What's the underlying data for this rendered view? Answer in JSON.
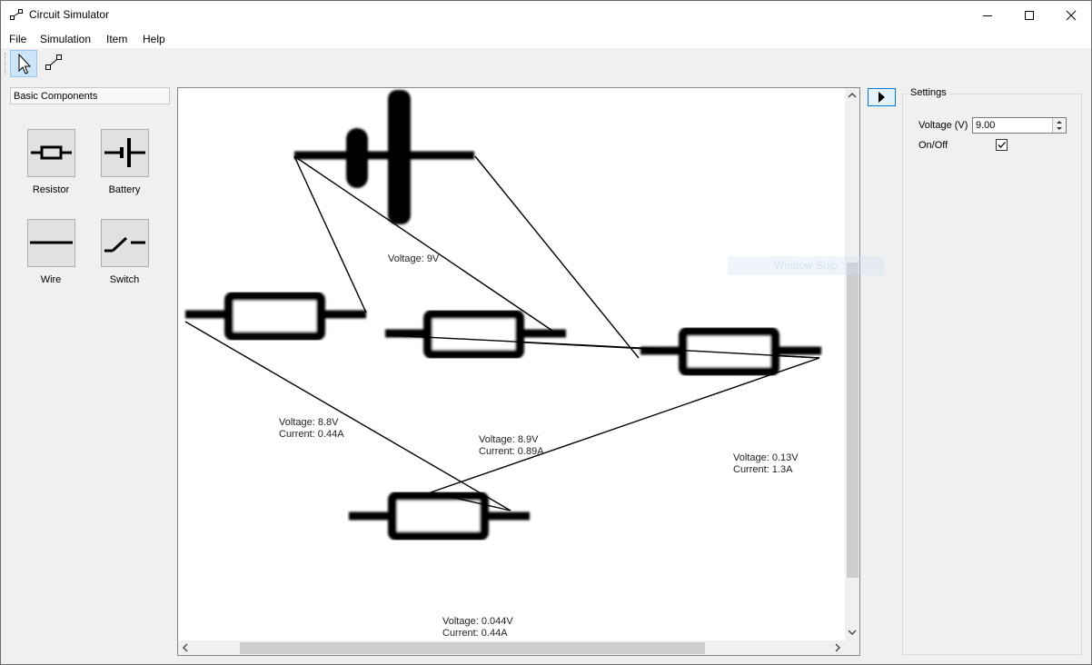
{
  "window": {
    "title": "Circuit Simulator"
  },
  "menu": [
    "File",
    "Simulation",
    "Item",
    "Help"
  ],
  "toolbar": {
    "tools": [
      "select-tool",
      "connect-tool"
    ]
  },
  "palette": {
    "header": "Basic Components",
    "components": [
      {
        "label": "Resistor",
        "icon": "resistor-icon"
      },
      {
        "label": "Battery",
        "icon": "battery-icon"
      },
      {
        "label": "Wire",
        "icon": "wire-icon"
      },
      {
        "label": "Switch",
        "icon": "switch-icon"
      }
    ]
  },
  "canvas": {
    "labels": [
      {
        "lines": [
          "Voltage: 9V"
        ]
      },
      {
        "lines": [
          "Voltage: 8.8V",
          "Current: 0.44A"
        ]
      },
      {
        "lines": [
          "Voltage: 8.9V",
          "Current: 0.89A"
        ]
      },
      {
        "lines": [
          "Voltage: 0.13V",
          "Current: 1.3A"
        ]
      },
      {
        "lines": [
          "Voltage: 0.044V",
          "Current: 0.44A"
        ]
      }
    ]
  },
  "settings": {
    "title": "Settings",
    "voltage_label": "Voltage (V)",
    "voltage_value": "9.00",
    "onoff_label": "On/Off",
    "onoff_checked": true
  },
  "overlay": {
    "snip_text": "Window Snip"
  },
  "colors": {
    "selected_tool": "#cce4f7",
    "accent": "#0078d7"
  }
}
